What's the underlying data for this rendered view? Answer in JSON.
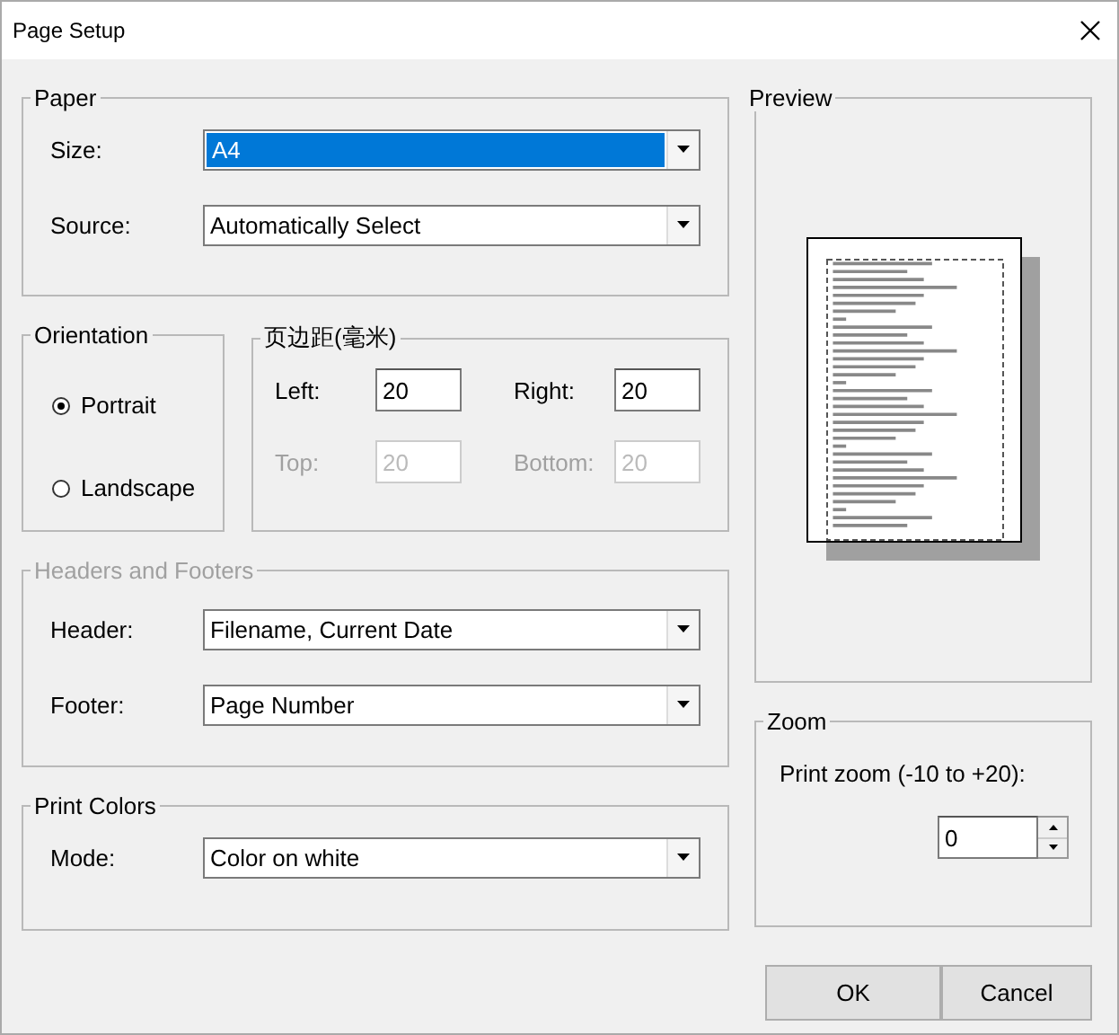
{
  "window": {
    "title": "Page Setup"
  },
  "paper": {
    "title": "Paper",
    "fields": [
      {
        "label": "Size:",
        "value": "A4",
        "selected": true
      },
      {
        "label": "Source:",
        "value": "Automatically Select",
        "selected": false
      }
    ]
  },
  "orientation": {
    "title": "Orientation",
    "options": [
      {
        "label": "Portrait",
        "selected": true
      },
      {
        "label": "Landscape",
        "selected": false
      }
    ]
  },
  "margins": {
    "title": "页边距(毫米)",
    "fields": [
      {
        "label": "Left:",
        "value": "20",
        "disabled": false
      },
      {
        "label": "Right:",
        "value": "20",
        "disabled": false
      },
      {
        "label": "Top:",
        "value": "20",
        "disabled": true
      },
      {
        "label": "Bottom:",
        "value": "20",
        "disabled": true
      }
    ]
  },
  "headers_footers": {
    "title": "Headers and Footers",
    "disabled": true,
    "fields": [
      {
        "label": "Header:",
        "value": "Filename, Current Date",
        "selected": false
      },
      {
        "label": "Footer:",
        "value": "Page Number",
        "selected": false
      }
    ]
  },
  "print_colors": {
    "title": "Print Colors",
    "fields": [
      {
        "label": "Mode:",
        "value": "Color on white",
        "selected": false
      }
    ]
  },
  "preview": {
    "title": "Preview"
  },
  "zoom": {
    "title": "Zoom",
    "label": "Print zoom (-10 to +20):",
    "value": "0"
  },
  "buttons": [
    "OK",
    "Cancel"
  ]
}
